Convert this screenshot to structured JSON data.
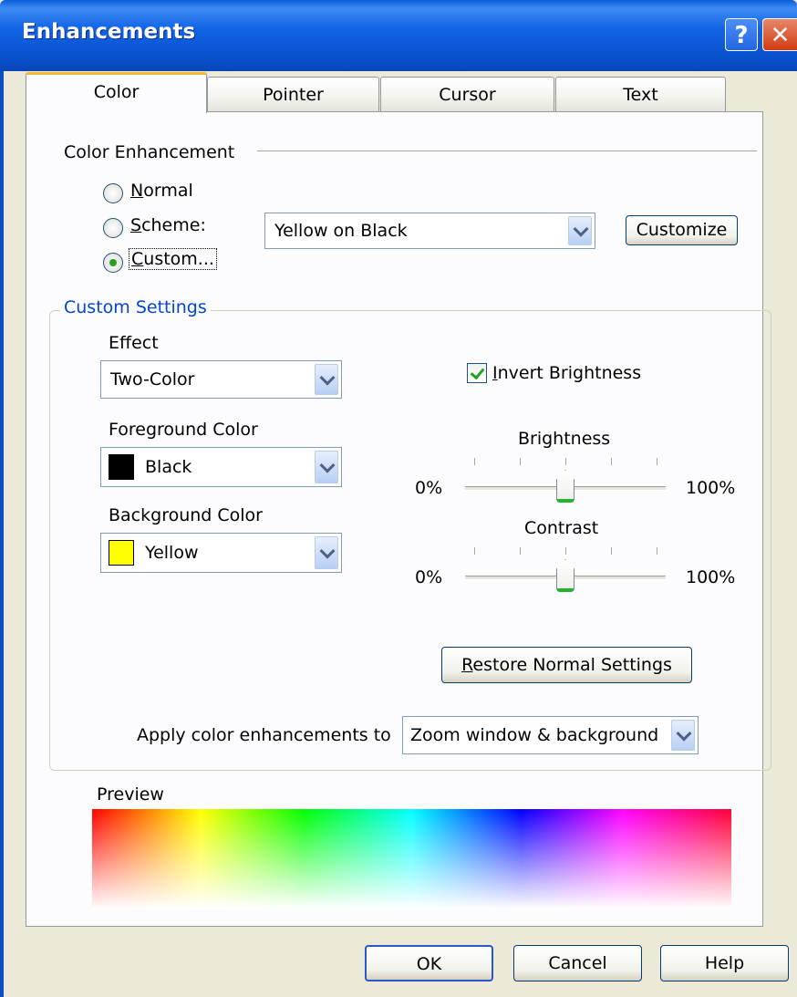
{
  "window": {
    "title": "Enhancements",
    "help_glyph": "?",
    "close_glyph": "✕"
  },
  "tabs": [
    {
      "label": "Color",
      "active": true
    },
    {
      "label": "Pointer",
      "active": false
    },
    {
      "label": "Cursor",
      "active": false
    },
    {
      "label": "Text",
      "active": false
    }
  ],
  "color_enhancement": {
    "heading": "Color Enhancement",
    "radios": [
      {
        "label_underline": "N",
        "label_rest": "ormal",
        "selected": false
      },
      {
        "label_underline": "S",
        "label_rest": "cheme:",
        "selected": false
      },
      {
        "label_underline": "C",
        "label_rest": "ustom...",
        "selected": true
      }
    ],
    "scheme_value": "Yellow on Black",
    "customize_label": "Customize"
  },
  "custom_settings": {
    "heading": "Custom Settings",
    "effect_label": "Effect",
    "effect_value": "Two-Color",
    "foreground_label": "Foreground Color",
    "foreground_value": "Black",
    "foreground_swatch": "#000000",
    "background_label": "Background Color",
    "background_value": "Yellow",
    "background_swatch": "#ffff00",
    "invert_underline": "I",
    "invert_rest": "nvert Brightness",
    "invert_checked": true,
    "brightness": {
      "label": "Brightness",
      "min_label": "0%",
      "max_label": "100%",
      "value_pct": 50
    },
    "contrast": {
      "label": "Contrast",
      "min_label": "0%",
      "max_label": "100%",
      "value_pct": 50
    },
    "restore_underline": "R",
    "restore_rest": "estore Normal Settings",
    "apply_label": "Apply color enhancements to",
    "apply_value": "Zoom window & background"
  },
  "preview": {
    "label": "Preview"
  },
  "footer": {
    "ok": "OK",
    "cancel": "Cancel",
    "help": "Help"
  },
  "colors": {
    "titlebar": "#0a53d0",
    "dialog_bg": "#ece9d8",
    "panel_bg": "#fcfcfe",
    "group_label": "#0046d5",
    "active_tab_accent": "#f4b73a"
  }
}
